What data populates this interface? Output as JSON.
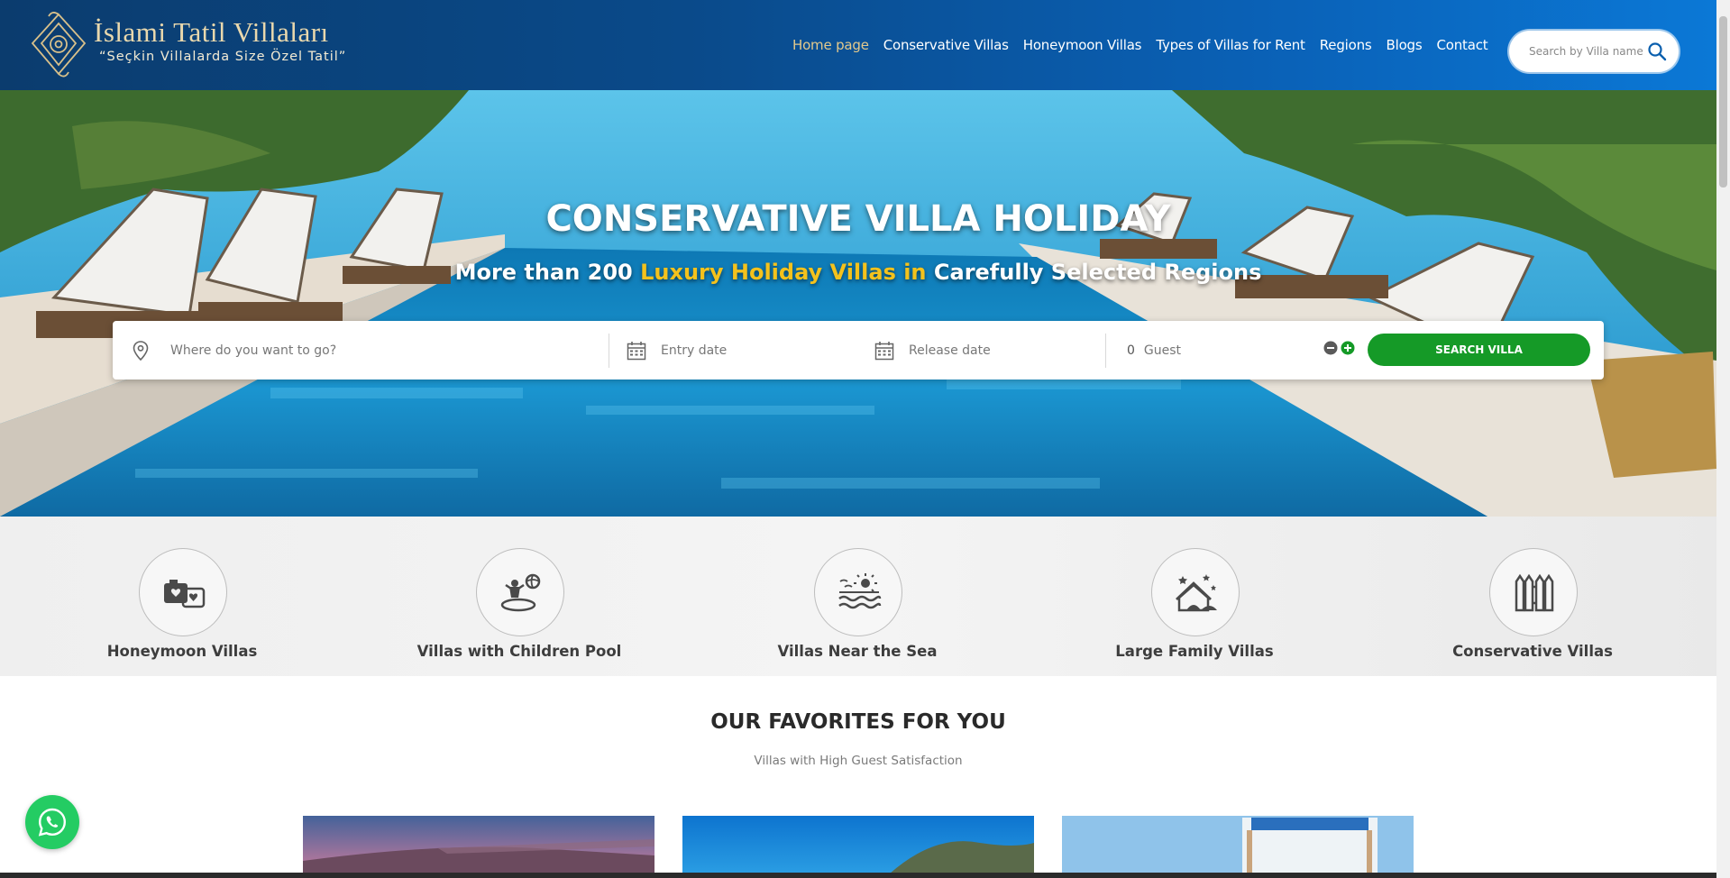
{
  "brand": {
    "title": "İslami Tatil Villaları",
    "slogan": "“Seçkin Villalarda Size Özel Tatil”"
  },
  "nav": {
    "items": [
      {
        "label": "Home page",
        "active": true
      },
      {
        "label": "Conservative Villas",
        "active": false
      },
      {
        "label": "Honeymoon Villas",
        "active": false
      },
      {
        "label": "Types of Villas for Rent",
        "active": false
      },
      {
        "label": "Regions",
        "active": false
      },
      {
        "label": "Blogs",
        "active": false
      },
      {
        "label": "Contact",
        "active": false
      }
    ],
    "search_placeholder": "Search by Villa name ..."
  },
  "hero": {
    "title": "CONSERVATIVE VILLA HOLIDAY",
    "subtitle_pre": "More than 200 ",
    "subtitle_highlight": "Luxury Holiday Villas in",
    "subtitle_post": " Carefully Selected Regions"
  },
  "booking": {
    "destination_placeholder": "Where do you want to go?",
    "entry_placeholder": "Entry date",
    "release_placeholder": "Release date",
    "guest_count": "0",
    "guest_label": "Guest",
    "search_label": "SEARCH VILLA"
  },
  "categories": [
    {
      "label": "Honeymoon Villas",
      "icon": "camera-hearts-icon"
    },
    {
      "label": "Villas with Children Pool",
      "icon": "child-pool-icon"
    },
    {
      "label": "Villas Near the Sea",
      "icon": "sea-sun-icon"
    },
    {
      "label": "Large Family Villas",
      "icon": "family-house-icon"
    },
    {
      "label": "Conservative Villas",
      "icon": "fence-icon"
    }
  ],
  "favorites": {
    "title": "OUR FAVORITES FOR YOU",
    "subtitle": "Villas with High Guest Satisfaction"
  },
  "colors": {
    "header_dark": "#0b3c6e",
    "header_light": "#0b78d6",
    "nav_active": "#e3c98c",
    "highlight": "#f4c21c",
    "search_button": "#159a27",
    "whatsapp": "#24cc63"
  }
}
